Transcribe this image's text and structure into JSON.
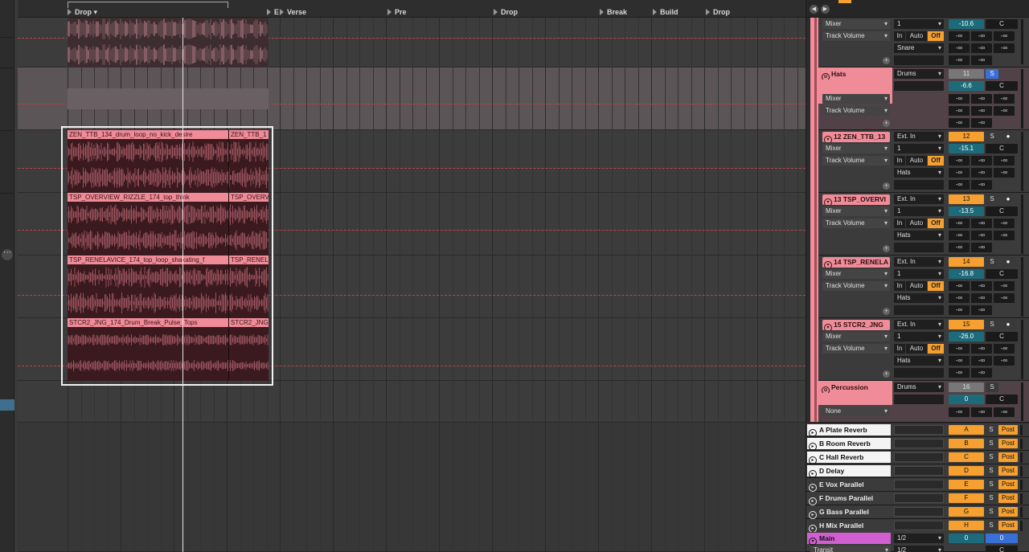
{
  "colors": {
    "clip_pink": "#f08c98",
    "clip_body": "#3a1a1e",
    "orange": "#f5a030",
    "blue": "#3a6fd6",
    "teal": "#1d6b7a",
    "main_purple": "#d25fd2",
    "dashed_red": "#c0404a"
  },
  "ruler": {
    "locators": [
      {
        "label": "Drop ▾"
      },
      {
        "label": "E"
      },
      {
        "label": "Verse"
      },
      {
        "label": "Pre"
      },
      {
        "label": "Drop"
      },
      {
        "label": "Break"
      },
      {
        "label": "Build"
      },
      {
        "label": "Drop"
      }
    ]
  },
  "clips": [
    {
      "name": "ZEN_TTB_134_drum_loop_no_kick_desire",
      "name2": "ZEN_TTB_1"
    },
    {
      "name": "TSP_OVERVIEW_RIZZLE_174_top_think",
      "name2": "TSP_OVERV"
    },
    {
      "name": "TSP_RENELAVICE_174_top_loop_shakating_f",
      "name2": "TSP_RENEL"
    },
    {
      "name": "STCR2_JNG_174_Drum_Break_Pulse_Tops",
      "name2": "STCR2_JNG"
    }
  ],
  "mixer": {
    "icons": {
      "back": "◀",
      "forward": "▶",
      "plus": "+"
    },
    "snare": {
      "mixer_label": "Mixer",
      "param_label": "Track Volume",
      "in_label": "1",
      "output": "Snare",
      "mon_in": "In",
      "mon_auto": "Auto",
      "mon_off": "Off",
      "vol": "-10.6",
      "pan": "C",
      "inf": "-∞"
    },
    "tracks": [
      {
        "title": "Hats",
        "input": "Drums",
        "mixer_label": "Mixer",
        "param_label": "Track Volume",
        "number": "11",
        "solo": "S",
        "vol": "-6.6",
        "pan": "C",
        "inf": "-∞"
      },
      {
        "title": "12 ZEN_TTB_13",
        "input": "Ext. In",
        "channel": "1",
        "output": "Hats",
        "mixer_label": "Mixer",
        "param_label": "Track Volume",
        "mon_in": "In",
        "mon_auto": "Auto",
        "mon_off": "Off",
        "number": "12",
        "solo": "S",
        "vol": "-15.1",
        "pan": "C",
        "inf": "-∞"
      },
      {
        "title": "13 TSP_OVERVI",
        "input": "Ext. In",
        "channel": "1",
        "output": "Hats",
        "mixer_label": "Mixer",
        "param_label": "Track Volume",
        "mon_in": "In",
        "mon_auto": "Auto",
        "mon_off": "Off",
        "number": "13",
        "solo": "S",
        "vol": "-13.5",
        "pan": "C",
        "inf": "-∞"
      },
      {
        "title": "14 TSP_RENELA",
        "input": "Ext. In",
        "channel": "1",
        "output": "Hats",
        "mixer_label": "Mixer",
        "param_label": "Track Volume",
        "mon_in": "In",
        "mon_auto": "Auto",
        "mon_off": "Off",
        "number": "14",
        "solo": "S",
        "vol": "-16.8",
        "pan": "C",
        "inf": "-∞"
      },
      {
        "title": "15 STCR2_JNG",
        "input": "Ext. In",
        "channel": "1",
        "output": "Hats",
        "mixer_label": "Mixer",
        "param_label": "Track Volume",
        "mon_in": "In",
        "mon_auto": "Auto",
        "mon_off": "Off",
        "number": "15",
        "solo": "S",
        "vol": "-26.0",
        "pan": "C",
        "inf": "-∞"
      },
      {
        "title": "Percussion",
        "input": "Drums",
        "mixer_label": "None",
        "number": "16",
        "solo": "S",
        "vol": "0",
        "pan": "C",
        "inf": "-∞"
      }
    ],
    "returns": [
      {
        "name": "A Plate Reverb",
        "letter": "A",
        "solo": "S",
        "post": "Post",
        "style": "white"
      },
      {
        "name": "B Room Reverb",
        "letter": "B",
        "solo": "S",
        "post": "Post",
        "style": "white"
      },
      {
        "name": "C Hall Reverb",
        "letter": "C",
        "solo": "S",
        "post": "Post",
        "style": "white"
      },
      {
        "name": "D Delay",
        "letter": "D",
        "solo": "S",
        "post": "Post",
        "style": "white"
      },
      {
        "name": "E Vox Parallel",
        "letter": "E",
        "solo": "S",
        "post": "Post",
        "style": "dark"
      },
      {
        "name": "F Drums Parallel",
        "letter": "F",
        "solo": "S",
        "post": "Post",
        "style": "dark"
      },
      {
        "name": "G Bass Parallel",
        "letter": "G",
        "solo": "S",
        "post": "Post",
        "style": "dark"
      },
      {
        "name": "H Mix Parallel",
        "letter": "H",
        "solo": "S",
        "post": "Post",
        "style": "dark"
      }
    ],
    "main": {
      "name": "Main",
      "cue": "1/2",
      "vol": "0",
      "vol2": "0",
      "transit": "Transit",
      "transit_cue": "1/2",
      "pan": "C"
    }
  }
}
